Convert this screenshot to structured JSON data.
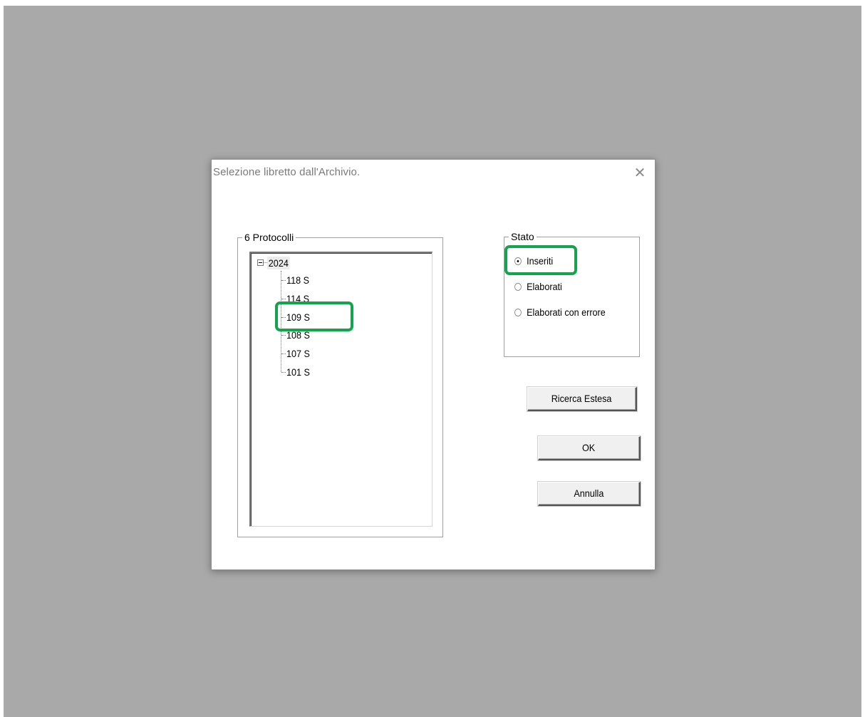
{
  "window": {
    "title": "Selezione libretto dall'Archivio.",
    "close_glyph": "✕"
  },
  "protocols_group": {
    "legend": "6 Protocolli",
    "tree": {
      "root": "2024",
      "items": [
        "118 S",
        "114 S",
        "109 S",
        "108 S",
        "107 S",
        "101 S"
      ]
    }
  },
  "status_group": {
    "legend": "Stato",
    "options": [
      {
        "label": "Inseriti",
        "checked": true
      },
      {
        "label": "Elaborati",
        "checked": false
      },
      {
        "label": "Elaborati con errore",
        "checked": false
      }
    ]
  },
  "buttons": {
    "extended_search": "Ricerca Estesa",
    "ok": "OK",
    "cancel": "Annulla"
  },
  "colors": {
    "highlight": "#14a44d",
    "desktop": "#a9a9a9"
  }
}
